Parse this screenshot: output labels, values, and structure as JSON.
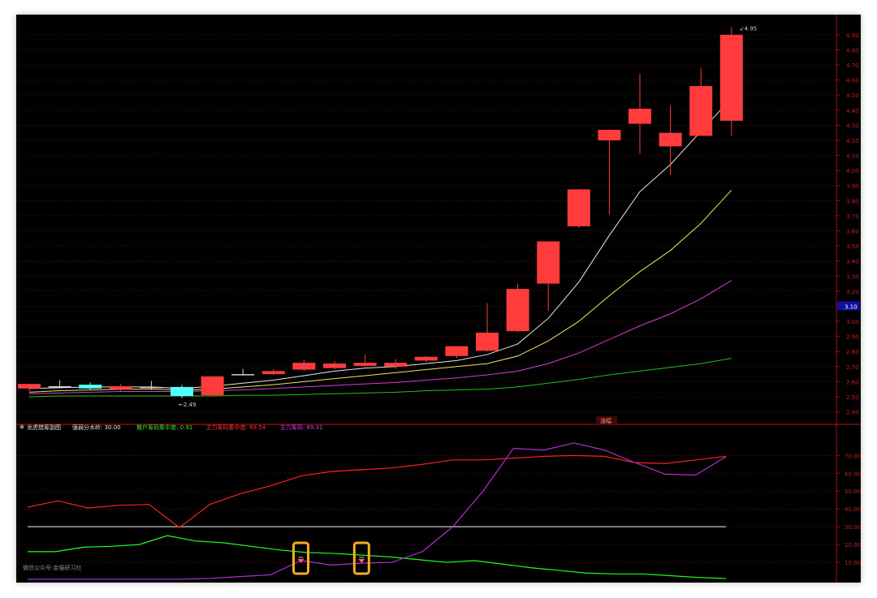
{
  "chart_data": [
    {
      "type": "candlestick",
      "ylim": [
        2.36,
        4.98
      ],
      "y_ticks": [
        "4.90",
        "4.80",
        "4.70",
        "4.60",
        "4.50",
        "4.40",
        "4.30",
        "4.20",
        "4.10",
        "4.00",
        "3.90",
        "3.80",
        "3.70",
        "3.60",
        "3.50",
        "3.40",
        "3.30",
        "3.20",
        "3.10",
        "3.00",
        "2.90",
        "2.80",
        "2.70",
        "2.60",
        "2.50",
        "2.40"
      ],
      "current_price_label": "3.10",
      "current_price": 3.1,
      "high_label": "4.95",
      "high_value": 4.95,
      "low_label": "2.49",
      "low_value": 2.49,
      "bottom_tag": "涨幅",
      "candles": [
        {
          "o": 2.555,
          "h": 2.575,
          "l": 2.535,
          "c": 2.585,
          "col": "down"
        },
        {
          "o": 2.57,
          "h": 2.61,
          "l": 2.555,
          "c": 2.57,
          "col": "doji"
        },
        {
          "o": 2.58,
          "h": 2.595,
          "l": 2.545,
          "c": 2.555,
          "col": "cyan"
        },
        {
          "o": 2.57,
          "h": 2.585,
          "l": 2.535,
          "c": 2.55,
          "col": "down"
        },
        {
          "o": 2.565,
          "h": 2.605,
          "l": 2.545,
          "c": 2.565,
          "col": "doji"
        },
        {
          "o": 2.565,
          "h": 2.58,
          "l": 2.49,
          "c": 2.505,
          "col": "cyan"
        },
        {
          "o": 2.51,
          "h": 2.635,
          "l": 2.505,
          "c": 2.635,
          "col": "up"
        },
        {
          "o": 2.65,
          "h": 2.685,
          "l": 2.64,
          "c": 2.65,
          "col": "doji"
        },
        {
          "o": 2.65,
          "h": 2.685,
          "l": 2.645,
          "c": 2.67,
          "col": "up"
        },
        {
          "o": 2.68,
          "h": 2.745,
          "l": 2.67,
          "c": 2.725,
          "col": "up"
        },
        {
          "o": 2.69,
          "h": 2.735,
          "l": 2.68,
          "c": 2.72,
          "col": "up"
        },
        {
          "o": 2.705,
          "h": 2.78,
          "l": 2.7,
          "c": 2.725,
          "col": "up"
        },
        {
          "o": 2.7,
          "h": 2.75,
          "l": 2.685,
          "c": 2.725,
          "col": "up"
        },
        {
          "o": 2.74,
          "h": 2.77,
          "l": 2.73,
          "c": 2.765,
          "col": "up"
        },
        {
          "o": 2.77,
          "h": 2.835,
          "l": 2.755,
          "c": 2.835,
          "col": "up"
        },
        {
          "o": 2.805,
          "h": 3.12,
          "l": 2.8,
          "c": 2.925,
          "col": "up"
        },
        {
          "o": 2.935,
          "h": 3.25,
          "l": 2.93,
          "c": 3.215,
          "col": "up"
        },
        {
          "o": 3.25,
          "h": 3.53,
          "l": 3.07,
          "c": 3.53,
          "col": "up"
        },
        {
          "o": 3.63,
          "h": 3.88,
          "l": 3.62,
          "c": 3.875,
          "col": "up"
        },
        {
          "o": 4.2,
          "h": 4.27,
          "l": 3.71,
          "c": 4.27,
          "col": "up"
        },
        {
          "o": 4.31,
          "h": 4.64,
          "l": 4.11,
          "c": 4.41,
          "col": "up"
        },
        {
          "o": 4.16,
          "h": 4.43,
          "l": 3.97,
          "c": 4.25,
          "col": "up"
        },
        {
          "o": 4.23,
          "h": 4.68,
          "l": 4.23,
          "c": 4.56,
          "col": "up"
        },
        {
          "o": 4.33,
          "h": 4.95,
          "l": 4.23,
          "c": 4.9,
          "col": "up"
        }
      ],
      "ma": [
        {
          "color": "#e8e8e8",
          "values": [
            2.555,
            2.56,
            2.565,
            2.565,
            2.565,
            2.555,
            2.57,
            2.59,
            2.61,
            2.64,
            2.67,
            2.69,
            2.7,
            2.72,
            2.74,
            2.78,
            2.85,
            3.02,
            3.26,
            3.57,
            3.86,
            4.04,
            4.26,
            4.48
          ]
        },
        {
          "color": "#e8e860",
          "values": [
            2.53,
            2.54,
            2.545,
            2.55,
            2.55,
            2.545,
            2.55,
            2.565,
            2.58,
            2.6,
            2.62,
            2.64,
            2.66,
            2.68,
            2.7,
            2.72,
            2.77,
            2.87,
            3.0,
            3.17,
            3.33,
            3.47,
            3.65,
            3.87
          ]
        },
        {
          "color": "#d040d0",
          "values": [
            2.52,
            2.525,
            2.53,
            2.535,
            2.535,
            2.535,
            2.54,
            2.545,
            2.555,
            2.565,
            2.575,
            2.585,
            2.595,
            2.61,
            2.625,
            2.645,
            2.67,
            2.72,
            2.79,
            2.88,
            2.97,
            3.05,
            3.15,
            3.27
          ]
        },
        {
          "color": "#20c020",
          "values": [
            2.5,
            2.505,
            2.505,
            2.505,
            2.505,
            2.505,
            2.505,
            2.51,
            2.51,
            2.515,
            2.52,
            2.525,
            2.53,
            2.54,
            2.545,
            2.55,
            2.565,
            2.59,
            2.615,
            2.645,
            2.67,
            2.695,
            2.72,
            2.755
          ]
        }
      ]
    },
    {
      "type": "line",
      "title": "龙虎猎筹副图",
      "legend": [
        {
          "text": "强弱分水岭: 30.00",
          "color": "#e0e0e0"
        },
        {
          "text": "散户筹码集中度: 0.91",
          "color": "#30e030"
        },
        {
          "text": "主力筹码集中度: 69.54",
          "color": "#ff3030"
        },
        {
          "text": "主力筹码: 69.31",
          "color": "#c040e0"
        }
      ],
      "ylim": [
        0,
        82
      ],
      "y_ticks": [
        "70.00",
        "60.00",
        "50.00",
        "40.00",
        "30.00",
        "20.00",
        "10.00"
      ],
      "watermark": "微信公众号:金猫研习社",
      "series": [
        {
          "name": "强弱分水岭",
          "color": "#c8c8c8",
          "values": [
            30,
            30,
            30,
            30,
            30,
            30,
            30,
            30,
            30,
            30,
            30,
            30,
            30,
            30,
            30,
            30,
            30,
            30,
            30,
            30,
            30,
            30,
            30,
            30
          ]
        },
        {
          "name": "散户筹码集中度",
          "color": "#20ff20",
          "values": [
            16,
            16,
            18.5,
            19,
            20,
            25,
            22,
            21,
            19,
            17,
            15.5,
            15,
            14,
            13,
            11.5,
            10,
            11,
            9,
            7,
            5.5,
            4,
            3.5,
            3.5,
            2.5,
            1.5,
            0.91
          ]
        },
        {
          "name": "主力筹码集中度",
          "color": "#ff2020",
          "values": [
            41,
            44.5,
            40.5,
            42,
            42.5,
            29.5,
            42.5,
            48.5,
            53,
            58.5,
            61,
            62,
            63,
            65,
            67.5,
            67.5,
            68.5,
            69.5,
            70,
            69.5,
            66,
            65.5,
            67.5,
            69.54
          ]
        },
        {
          "name": "主力筹码",
          "color": "#b030d0",
          "values": [
            0.5,
            0.5,
            0.5,
            0.5,
            0.5,
            0.5,
            1,
            2,
            3,
            11,
            8.5,
            9.5,
            10,
            16,
            30,
            50,
            74,
            73,
            77,
            73,
            66,
            59.5,
            59,
            69.31
          ]
        }
      ],
      "markers": [
        9,
        11
      ],
      "highlight_color": "#f0b020"
    }
  ]
}
